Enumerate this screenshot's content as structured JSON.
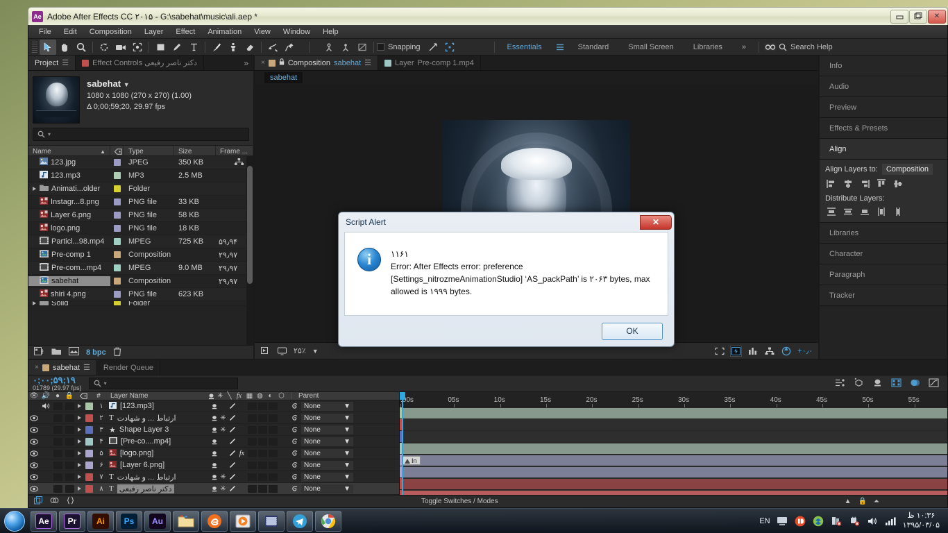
{
  "window": {
    "app_badge": "Ae",
    "title": "Adobe After Effects CC ۲۰۱۵ - G:\\sabehat\\music\\ali.aep *",
    "minimize": "—",
    "maximize": "❐",
    "close": "✕"
  },
  "menu": [
    "File",
    "Edit",
    "Composition",
    "Layer",
    "Effect",
    "Animation",
    "View",
    "Window",
    "Help"
  ],
  "toolbar": {
    "snapping_label": "Snapping",
    "workspaces": [
      "Essentials",
      "Standard",
      "Small Screen",
      "Libraries"
    ],
    "workspace_selected": "Essentials",
    "overflow": "»",
    "search_help": "Search Help"
  },
  "project": {
    "tabs": [
      {
        "label": "Project",
        "active": true
      },
      {
        "label": "Effect Controls دکتر ناصر رفیعی",
        "active": false
      }
    ],
    "overflow": "»",
    "item_name": "sabehat",
    "dimensions": "1080 x 1080  (270 x 270) (1.00)",
    "duration": "Δ 0;00;59;20, 29.97 fps",
    "search_placeholder": "",
    "columns": [
      "Name",
      "Type",
      "Size",
      "Frame ..."
    ],
    "files": [
      {
        "name": "123.jpg",
        "type": "JPEG",
        "size": "350 KB",
        "rate": "",
        "tag": "#9b9bc4",
        "icon": "#5a7fa8",
        "kind": "image"
      },
      {
        "name": "123.mp3",
        "type": "MP3",
        "size": "2.5 MB",
        "rate": "",
        "tag": "#aecdb4",
        "icon": "#4a6f8f",
        "kind": "audio"
      },
      {
        "name": "Animati...older",
        "type": "Folder",
        "size": "",
        "rate": "",
        "tag": "#d7d031",
        "icon": "#a9a9a9",
        "kind": "folder"
      },
      {
        "name": "Instagr...8.png",
        "type": "PNG file",
        "size": "33 KB",
        "rate": "",
        "tag": "#9b9bc4",
        "icon": "#a23b3b",
        "kind": "png"
      },
      {
        "name": "Layer 6.png",
        "type": "PNG file",
        "size": "58 KB",
        "rate": "",
        "tag": "#9b9bc4",
        "icon": "#a23b3b",
        "kind": "png"
      },
      {
        "name": "logo.png",
        "type": "PNG file",
        "size": "18 KB",
        "rate": "",
        "tag": "#9b9bc4",
        "icon": "#a23b3b",
        "kind": "png"
      },
      {
        "name": "Particl...98.mp4",
        "type": "MPEG",
        "size": "725 KB",
        "rate": "۵۹٫۹۴",
        "tag": "#9fd0c4",
        "icon": "#d8d8d8",
        "kind": "video"
      },
      {
        "name": "Pre-comp 1",
        "type": "Composition",
        "size": "",
        "rate": "۲۹٫۹۷",
        "tag": "#c9a87c",
        "icon": "#3f7fb0",
        "kind": "comp"
      },
      {
        "name": "Pre-com...mp4",
        "type": "MPEG",
        "size": "9.0 MB",
        "rate": "۲۹٫۹۷",
        "tag": "#9fd0c4",
        "icon": "#d8d8d8",
        "kind": "video"
      },
      {
        "name": "sabehat",
        "type": "Composition",
        "size": "",
        "rate": "۲۹٫۹۷",
        "tag": "#c9a87c",
        "icon": "#3f7fb0",
        "kind": "comp",
        "selected": true
      },
      {
        "name": "shiri 4.png",
        "type": "PNG file",
        "size": "623 KB",
        "rate": "",
        "tag": "#9b9bc4",
        "icon": "#a23b3b",
        "kind": "png"
      }
    ],
    "footer_bpc": "8 bpc"
  },
  "viewer": {
    "tabs": [
      {
        "label": "Composition",
        "suffix": "sabehat",
        "active": true
      },
      {
        "label": "Layer",
        "suffix": "Pre-comp 1.mp4",
        "active": false
      }
    ],
    "comp_label": "sabehat",
    "zoom": "۲۵٪",
    "offset": "+۰٫۰"
  },
  "right_panels": [
    {
      "label": "Info",
      "active": false
    },
    {
      "label": "Audio",
      "active": false
    },
    {
      "label": "Preview",
      "active": false
    },
    {
      "label": "Effects & Presets",
      "active": false
    },
    {
      "label": "Align",
      "active": true
    },
    {
      "label": "Libraries",
      "active": false
    },
    {
      "label": "Character",
      "active": false
    },
    {
      "label": "Paragraph",
      "active": false
    },
    {
      "label": "Tracker",
      "active": false
    }
  ],
  "align": {
    "align_to_label": "Align Layers to:",
    "align_to_value": "Composition",
    "distribute_label": "Distribute Layers:"
  },
  "timeline": {
    "tabs": [
      {
        "label": "sabehat",
        "active": true
      },
      {
        "label": "Render Queue",
        "active": false
      }
    ],
    "timecode": "۰;۰۰;۵۹;۱۹",
    "frame_info": "01789 (29.97 fps)",
    "search_placeholder": "",
    "columns": [
      "#",
      "Layer Name",
      "Parent"
    ],
    "ruler_ticks": [
      ":00s",
      "05s",
      "10s",
      "15s",
      "20s",
      "25s",
      "30s",
      "35s",
      "40s",
      "45s",
      "50s",
      "55s"
    ],
    "parent_value": "None",
    "footer_label": "Toggle Switches / Modes",
    "layers": [
      {
        "num": "۱",
        "name": "[123.mp3]",
        "swatch": "#a8c5a8",
        "icon": "audio",
        "rtl": false,
        "bar": "#86998c",
        "audio": true,
        "video": false,
        "motion_blur": false,
        "fx": false
      },
      {
        "num": "۲",
        "name": "ارتباط ... و شهادت",
        "swatch": "#c0504d",
        "icon": "text",
        "rtl": true,
        "bar": "",
        "audio": false,
        "video": true,
        "motion_blur": true,
        "fx": false
      },
      {
        "num": "۳",
        "name": "Shape Layer 3",
        "swatch": "#5b6fbd",
        "icon": "shape",
        "rtl": false,
        "bar": "",
        "audio": false,
        "video": true,
        "motion_blur": true,
        "fx": false
      },
      {
        "num": "۴",
        "name": "[Pre-co....mp4]",
        "swatch": "#9fc7c4",
        "icon": "video",
        "rtl": false,
        "bar": "#86998c",
        "audio": false,
        "video": true,
        "motion_blur": false,
        "fx": false
      },
      {
        "num": "۵",
        "name": "[logo.png]",
        "swatch": "#a9a5cd",
        "icon": "png",
        "rtl": false,
        "bar": "#7d7f96",
        "audio": false,
        "video": true,
        "motion_blur": false,
        "fx": true
      },
      {
        "num": "۶",
        "name": "[Layer 6.png]",
        "swatch": "#a9a5cd",
        "icon": "png",
        "rtl": false,
        "bar": "#7d7f96",
        "audio": false,
        "video": true,
        "motion_blur": false,
        "fx": false
      },
      {
        "num": "۷",
        "name": "ارتباط ... و شهادت",
        "swatch": "#c0504d",
        "icon": "text",
        "rtl": true,
        "bar": "#8a4242",
        "audio": false,
        "video": true,
        "motion_blur": true,
        "fx": false
      },
      {
        "num": "۸",
        "name": "دکتر ناصر رفیعی",
        "swatch": "#c0504d",
        "icon": "text",
        "rtl": true,
        "bar": "#b85c5c",
        "audio": false,
        "video": true,
        "motion_blur": true,
        "fx": false,
        "selected": true
      }
    ],
    "in_badge": "In"
  },
  "dialog": {
    "title": "Script Alert",
    "close": "✕",
    "code": "۱۱۶۱",
    "line1": "Error: After Effects error: preference",
    "line2": "[Settings_nitrozmeAnimationStudio] ‘AS_packPath’ is ۲۰۶۳ bytes, max",
    "line3": "allowed is ۱۹۹۹ bytes.",
    "ok_label": "OK",
    "info_glyph": "i"
  },
  "taskbar": {
    "apps": [
      {
        "label": "Ae",
        "color": "#ffffff",
        "bg": "#1a1030",
        "border": "#a964d8"
      },
      {
        "label": "Pr",
        "color": "#ffffff",
        "bg": "#1a1030",
        "border": "#b06fe0"
      },
      {
        "label": "Ai",
        "color": "#ff9a00",
        "bg": "#330d00",
        "border": "#7a3d00"
      },
      {
        "label": "Ps",
        "color": "#31a8ff",
        "bg": "#001e36",
        "border": "#0a4a7a"
      },
      {
        "label": "Au",
        "color": "#9a8cff",
        "bg": "#12061f",
        "border": "#4b3a7a"
      }
    ],
    "language": "EN",
    "clock_time": "۱۰:۳۶ ظ",
    "clock_date": "۱۳۹۵/۰۳/۰۵"
  }
}
